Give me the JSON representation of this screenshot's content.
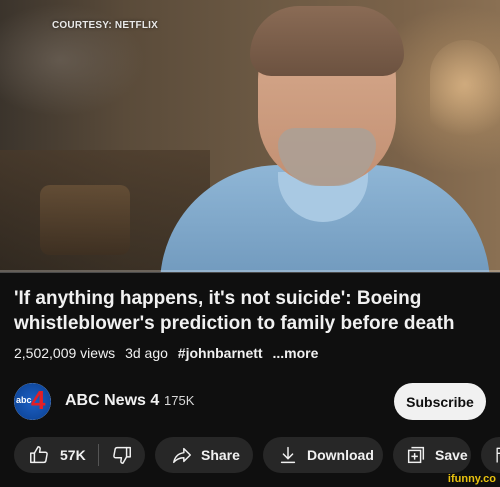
{
  "video": {
    "watermark": "COURTESY: NETFLIX"
  },
  "title": "'If anything happens, it's not suicide': Boeing whistleblower's prediction to family before death",
  "meta": {
    "views": "2,502,009 views",
    "age": "3d ago",
    "hashtag": "#johnbarnett",
    "more": "...more"
  },
  "channel": {
    "name": "ABC News 4",
    "subscribers": "175K",
    "subscribe_label": "Subscribe",
    "avatar_text": "abc",
    "avatar_number": "4"
  },
  "actions": {
    "like_count": "57K",
    "share_label": "Share",
    "download_label": "Download",
    "save_label": "Save"
  },
  "watermark": "ifunny.co",
  "colors": {
    "background": "#0f0f0f",
    "pill": "#272727",
    "subscribe_bg": "#f1f1f1"
  }
}
